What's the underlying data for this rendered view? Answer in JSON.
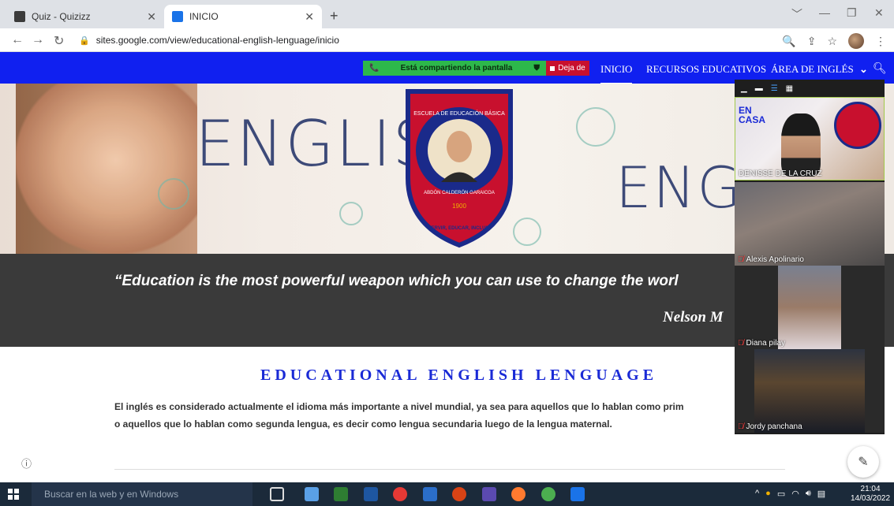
{
  "browser": {
    "tabs": [
      {
        "label": "Quiz - Quizizz",
        "active": false,
        "favicon_color": "#3b3b3b"
      },
      {
        "label": "INICIO",
        "active": true,
        "favicon_color": "#1a73e8"
      }
    ],
    "new_tab": "+",
    "url": "sites.google.com/view/educational-english-lenguage/inicio",
    "window_controls": [
      "﹀",
      "—",
      "❐",
      "✕"
    ]
  },
  "share_bar": {
    "text": "Está compartiendo la pantalla",
    "stop_label": "Deja de"
  },
  "site_nav": {
    "items": [
      "INICIO",
      "RECURSOS EDUCATIVOS",
      "ÁREA DE INGLÉS"
    ],
    "dropdown_glyph": "⌄",
    "active": "INICIO"
  },
  "hero": {
    "word_left": "ENGLISH",
    "word_right": "ENGL",
    "emblem_text_top": "ESCUELA DE EDUCACIÓN BÁSICA",
    "emblem_text_middle": "ABDÓN CALDERÓN GARAICOA",
    "emblem_year": "1900",
    "emblem_motto": "SERVIR, EDUCAR, INCLUIR"
  },
  "quote": {
    "text": "“Education is the most powerful weapon which you can use to change the worl",
    "author": "Nelson M"
  },
  "main": {
    "heading": "EDUCATIONAL ENGLISH LENGUAGE",
    "paragraph_line1": "El inglés es considerado actualmente el idioma más importante a nivel mundial, ya sea para aquellos que lo hablan como prim",
    "paragraph_line2": "o aquellos que lo hablan como segunda lengua, es decir como lengua secundaria luego de la lengua maternal."
  },
  "video_panel": {
    "tile1_overlay_line1": "EN",
    "tile1_overlay_line2": "CASA",
    "participants": [
      {
        "name": "DENISSE DE LA CRUZ",
        "muted": false
      },
      {
        "name": "Alexis Apolinario",
        "muted": true
      },
      {
        "name": "Diana pilay",
        "muted": true
      },
      {
        "name": "Jordy panchana",
        "muted": true
      }
    ]
  },
  "taskbar": {
    "search_placeholder": "Buscar en la web y en Windows",
    "time": "21:04",
    "date": "14/03/2022",
    "app_icon_colors": [
      "#5aa0e6",
      "#2e7d32",
      "#1e56a0",
      "#e53935",
      "#2b6ec9",
      "#d84315",
      "#5b4ab0",
      "#ff7a2f",
      "#4caf50",
      "#1a73e8"
    ]
  },
  "colors": {
    "site_header": "#1020f0",
    "heading_blue": "#1a2ad6",
    "quote_band": "#3a3a3a"
  }
}
